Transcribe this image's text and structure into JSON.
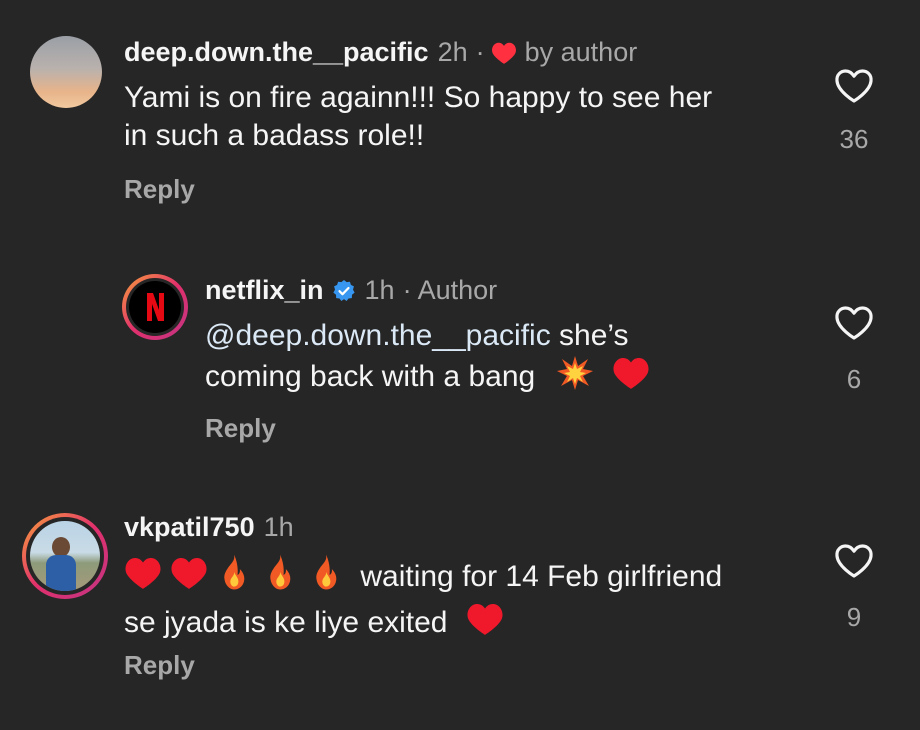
{
  "comments": [
    {
      "username": "deep.down.the__pacific",
      "time": "2h",
      "badge": "by author",
      "line1": "Yami is on fire againn!!! So happy to see her",
      "line2": "in such a badass role!!",
      "reply": "Reply",
      "likes": "36"
    },
    {
      "username": "netflix_in",
      "verified_icon": "verified-badge-icon",
      "time": "1h",
      "badge": "Author",
      "mention": "@deep.down.the__pacific",
      "line1_rest": " she’s",
      "line2": "coming back with a bang",
      "reply": "Reply",
      "likes": "6"
    },
    {
      "username": "vkpatil750",
      "time": "1h",
      "line1_text": "waiting for 14 Feb girlfriend",
      "line2": "se jyada is ke liye exited",
      "reply": "Reply",
      "likes": "9"
    }
  ],
  "icons": {
    "heart_outline": "heart-outline-icon",
    "red_heart": "red-heart-emoji",
    "fire": "fire-emoji",
    "collision": "collision-emoji"
  },
  "colors": {
    "background": "#262626",
    "text": "#f5f5f5",
    "muted": "#a8a8a8",
    "verified": "#3797f0",
    "heart_red": "#ff3040"
  }
}
